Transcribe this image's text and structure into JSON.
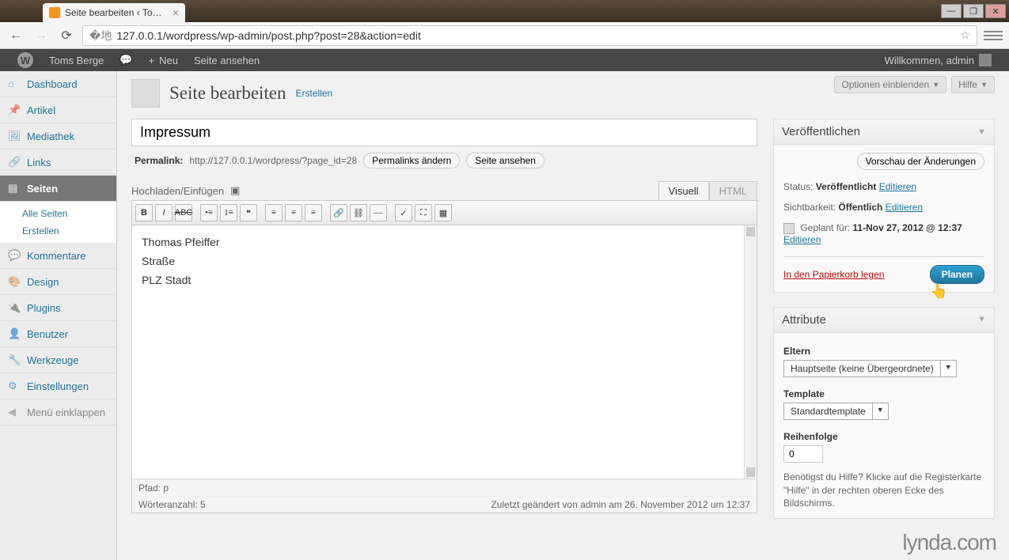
{
  "browser": {
    "tab_title": "Seite bearbeiten ‹ Toms B…",
    "url": "127.0.0.1/wordpress/wp-admin/post.php?post=28&action=edit"
  },
  "adminbar": {
    "site_name": "Toms Berge",
    "new_label": "Neu",
    "view_label": "Seite ansehen",
    "welcome": "Willkommen, admin"
  },
  "sidebar": {
    "items": [
      {
        "label": "Dashboard",
        "icon": "home"
      },
      {
        "label": "Artikel",
        "icon": "pin"
      },
      {
        "label": "Mediathek",
        "icon": "media"
      },
      {
        "label": "Links",
        "icon": "link"
      },
      {
        "label": "Seiten",
        "icon": "page",
        "current": true
      },
      {
        "label": "Kommentare",
        "icon": "comment"
      },
      {
        "label": "Design",
        "icon": "design"
      },
      {
        "label": "Plugins",
        "icon": "plugin"
      },
      {
        "label": "Benutzer",
        "icon": "user"
      },
      {
        "label": "Werkzeuge",
        "icon": "tool"
      },
      {
        "label": "Einstellungen",
        "icon": "settings"
      }
    ],
    "submenu": [
      "Alle Seiten",
      "Erstellen"
    ],
    "collapse": "Menü einklappen"
  },
  "screen_tabs": {
    "options": "Optionen einblenden",
    "help": "Hilfe"
  },
  "header": {
    "title": "Seite bearbeiten",
    "add_new": "Erstellen"
  },
  "post": {
    "title": "Impressum",
    "permalink_label": "Permalink:",
    "permalink_url": "http://127.0.0.1/wordpress/?page_id=28",
    "permalink_edit": "Permalinks ändern",
    "permalink_view": "Seite ansehen",
    "upload_label": "Hochladen/Einfügen",
    "tabs": {
      "visual": "Visuell",
      "html": "HTML"
    },
    "content_lines": [
      "Thomas Pfeiffer",
      "Straße",
      "PLZ Stadt"
    ],
    "path_label": "Pfad:",
    "path_value": "p",
    "wordcount_label": "Wörteranzahl:",
    "wordcount_value": "5",
    "last_edited": "Zuletzt geändert von admin am 26. November 2012 um 12:37"
  },
  "publish": {
    "box_title": "Veröffentlichen",
    "preview": "Vorschau der Änderungen",
    "status_label": "Status:",
    "status_value": "Veröffentlicht",
    "visibility_label": "Sichtbarkeit:",
    "visibility_value": "Öffentlich",
    "scheduled_label": "Geplant für:",
    "scheduled_value": "11-Nov 27, 2012 @ 12:37",
    "edit": "Editieren",
    "trash": "In den Papierkorb legen",
    "submit": "Planen"
  },
  "attributes": {
    "box_title": "Attribute",
    "parent_label": "Eltern",
    "parent_value": "Hauptseite (keine Übergeordnete)",
    "template_label": "Template",
    "template_value": "Standardtemplate",
    "order_label": "Reihenfolge",
    "order_value": "0",
    "help": "Benötigst du Hilfe? Klicke auf die Registerkarte \"Hilfe\" in der rechten oberen Ecke des Bildschirms."
  },
  "watermark": "lynda.com"
}
